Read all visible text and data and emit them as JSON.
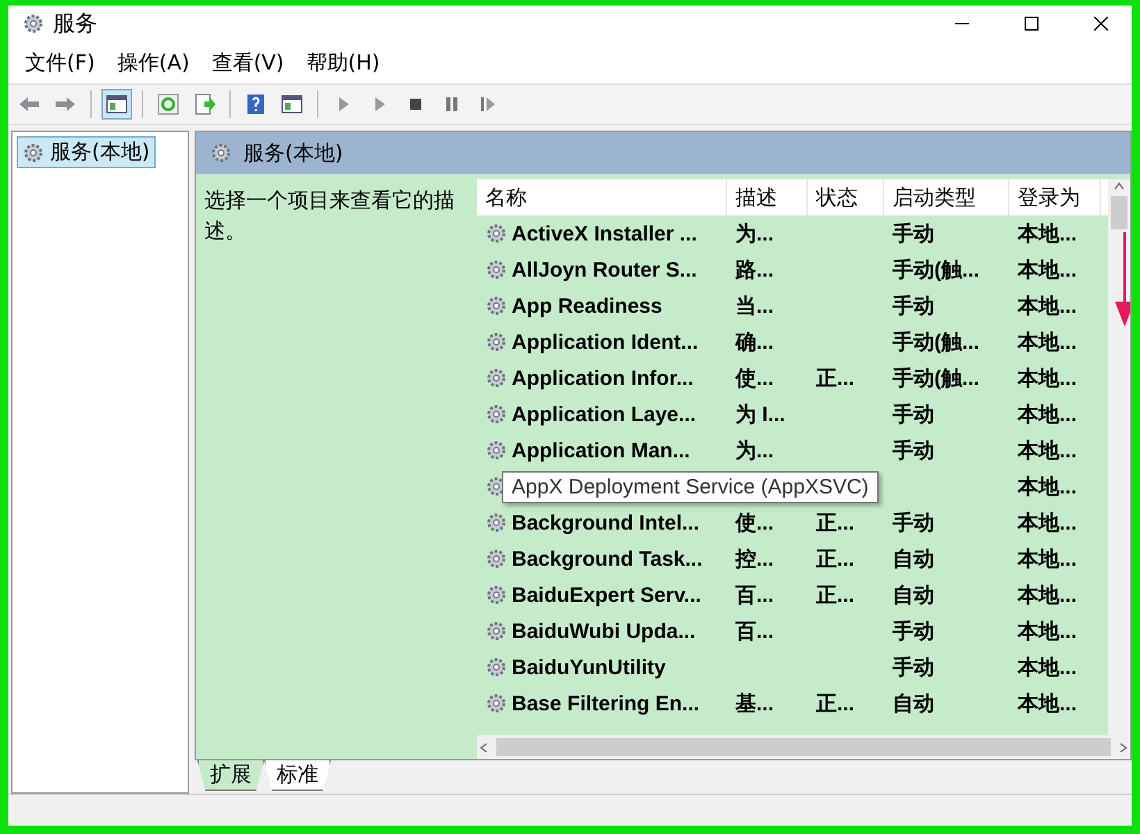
{
  "window": {
    "title": "服务"
  },
  "menu": [
    "文件(F)",
    "操作(A)",
    "查看(V)",
    "帮助(H)"
  ],
  "tree": [
    {
      "label": "服务(本地)",
      "selected": true
    }
  ],
  "panel": {
    "title": "服务(本地)",
    "description": "选择一个项目来查看它的描述。"
  },
  "table": {
    "columns": [
      "名称",
      "描述",
      "状态",
      "启动类型",
      "登录为"
    ],
    "rows": [
      {
        "name": "ActiveX Installer ...",
        "description": "为...",
        "startup": "手动",
        "logon": "本地..."
      },
      {
        "name": "AllJoyn Router S...",
        "description": "路...",
        "startup": "手动(触...",
        "logon": "本地..."
      },
      {
        "name": "App Readiness",
        "description": "当...",
        "startup": "手动",
        "logon": "本地..."
      },
      {
        "name": "Application Ident...",
        "description": "确...",
        "startup": "手动(触...",
        "logon": "本地..."
      },
      {
        "name": "Application Infor...",
        "description": "使...",
        "status": "正...",
        "startup": "手动(触...",
        "logon": "本地..."
      },
      {
        "name": "Application Laye...",
        "description": "为 I...",
        "startup": "手动",
        "logon": "本地..."
      },
      {
        "name": "Application Man...",
        "description": "为...",
        "startup": "手动",
        "logon": "本地..."
      },
      {
        "logon": "本地..."
      },
      {
        "name": "Background Intel...",
        "description": "使...",
        "status": "正...",
        "startup": "手动",
        "logon": "本地..."
      },
      {
        "name": "Background Task...",
        "description": "控...",
        "status": "正...",
        "startup": "自动",
        "logon": "本地..."
      },
      {
        "name": "BaiduExpert Serv...",
        "description": "百...",
        "status": "正...",
        "startup": "自动",
        "logon": "本地..."
      },
      {
        "name": "BaiduWubi Upda...",
        "description": "百...",
        "startup": "手动",
        "logon": "本地..."
      },
      {
        "name": "BaiduYunUtility",
        "startup": "手动",
        "logon": "本地..."
      },
      {
        "name": "Base Filtering En...",
        "description": "基...",
        "status": "正...",
        "startup": "自动",
        "logon": "本地..."
      }
    ]
  },
  "tooltip": {
    "text": "AppX Deployment Service (AppXSVC)"
  },
  "tabs": [
    {
      "label": "扩展",
      "selected": true
    },
    {
      "label": "标准",
      "selected": false
    }
  ]
}
